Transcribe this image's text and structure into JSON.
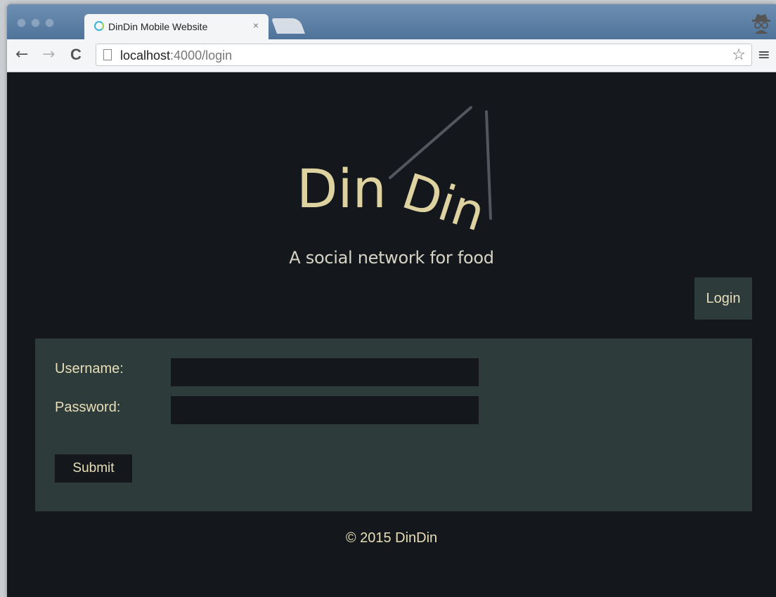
{
  "browser": {
    "tab_title": "DinDin Mobile Website",
    "tab_close": "×",
    "url_host": "localhost",
    "url_path": ":4000/login",
    "back": "←",
    "forward": "→",
    "reload": "C",
    "star": "☆",
    "menu": "≡"
  },
  "page": {
    "logo": {
      "word1": "Din",
      "word2": "Din"
    },
    "tagline": "A social network for food",
    "login_button": "Login",
    "form": {
      "username_label": "Username:",
      "password_label": "Password:",
      "username_value": "",
      "password_value": "",
      "submit_label": "Submit"
    },
    "footer": "© 2015 DinDin"
  },
  "colors": {
    "background": "#14181d",
    "panel": "#2d3b3a",
    "accent_text": "#e8dfb8",
    "logo_text": "#ddd2a0"
  }
}
